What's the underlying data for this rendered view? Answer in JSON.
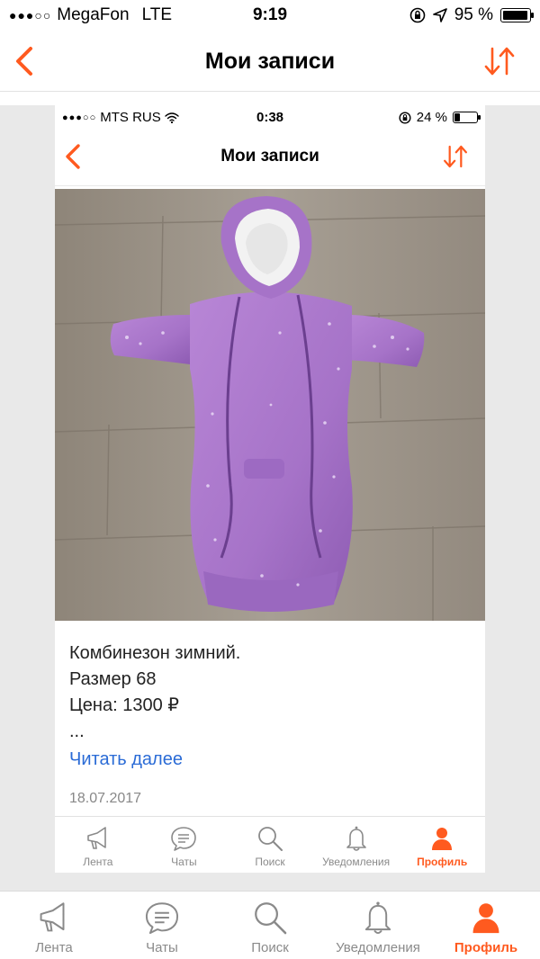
{
  "status_bar": {
    "carrier": "MegaFon",
    "network": "LTE",
    "time": "9:19",
    "battery": "95 %",
    "battery_level": 0.95
  },
  "nav": {
    "title": "Мои записи"
  },
  "inner": {
    "status_bar": {
      "carrier": "MTS RUS",
      "time": "0:38",
      "battery": "24 %",
      "battery_level": 0.24
    },
    "nav": {
      "title": "Мои записи"
    },
    "post": {
      "lines": [
        "Комбинезон зимний.",
        "Размер 68",
        "Цена: 1300 ₽",
        "..."
      ],
      "read_more": "Читать далее",
      "date": "18.07.2017"
    },
    "tabs": [
      {
        "label": "Лента",
        "icon": "megaphone-icon"
      },
      {
        "label": "Чаты",
        "icon": "chat-icon"
      },
      {
        "label": "Поиск",
        "icon": "search-icon"
      },
      {
        "label": "Уведомления",
        "icon": "bell-icon"
      },
      {
        "label": "Профиль",
        "icon": "profile-icon",
        "active": true
      }
    ]
  },
  "tabs": [
    {
      "label": "Лента",
      "icon": "megaphone-icon"
    },
    {
      "label": "Чаты",
      "icon": "chat-icon"
    },
    {
      "label": "Поиск",
      "icon": "search-icon"
    },
    {
      "label": "Уведомления",
      "icon": "bell-icon"
    },
    {
      "label": "Профиль",
      "icon": "profile-icon",
      "active": true
    }
  ],
  "colors": {
    "accent": "#ff5a1f",
    "link": "#2a6bd6",
    "tab_inactive": "#8a8a8a"
  }
}
